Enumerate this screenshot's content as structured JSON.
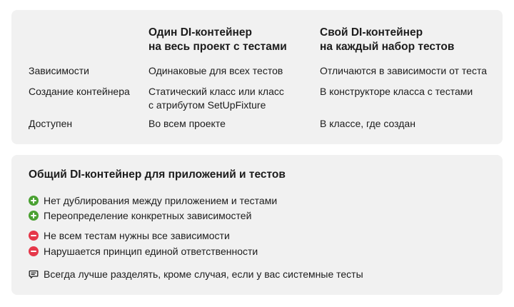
{
  "comparison": {
    "columns": [
      "Один DI-контейнер\nна весь проект с тестами",
      "Свой DI-контейнер\nна каждый набор тестов"
    ],
    "rows": [
      {
        "label": "Зависимости",
        "values": [
          "Одинаковые для всех тестов",
          "Отличаются в зависимости от теста"
        ]
      },
      {
        "label": "Создание контейнера",
        "values": [
          "Статический класс или класс\nс атрибутом SetUpFixture",
          "В конструкторе класса с тестами"
        ]
      },
      {
        "label": "Доступен",
        "values": [
          "Во всем проекте",
          "В классе, где создан"
        ]
      }
    ]
  },
  "notes": {
    "title": "Общий DI-контейнер для приложений и тестов",
    "pros": [
      "Нет дублирования между приложением и тестами",
      "Переопределение конкретных зависимостей"
    ],
    "cons": [
      "Не всем тестам нужны все зависимости",
      "Нарушается принцип единой ответственности"
    ],
    "tip": "Всегда лучше разделять, кроме случая, если у вас системные тесты"
  },
  "icons": {
    "pro": "plus-circle-icon",
    "con": "minus-circle-icon",
    "tip": "chat-bubble-icon"
  },
  "colors": {
    "card_background": "#f1f1f1",
    "pro": "#4aa132",
    "con": "#e5384a"
  }
}
